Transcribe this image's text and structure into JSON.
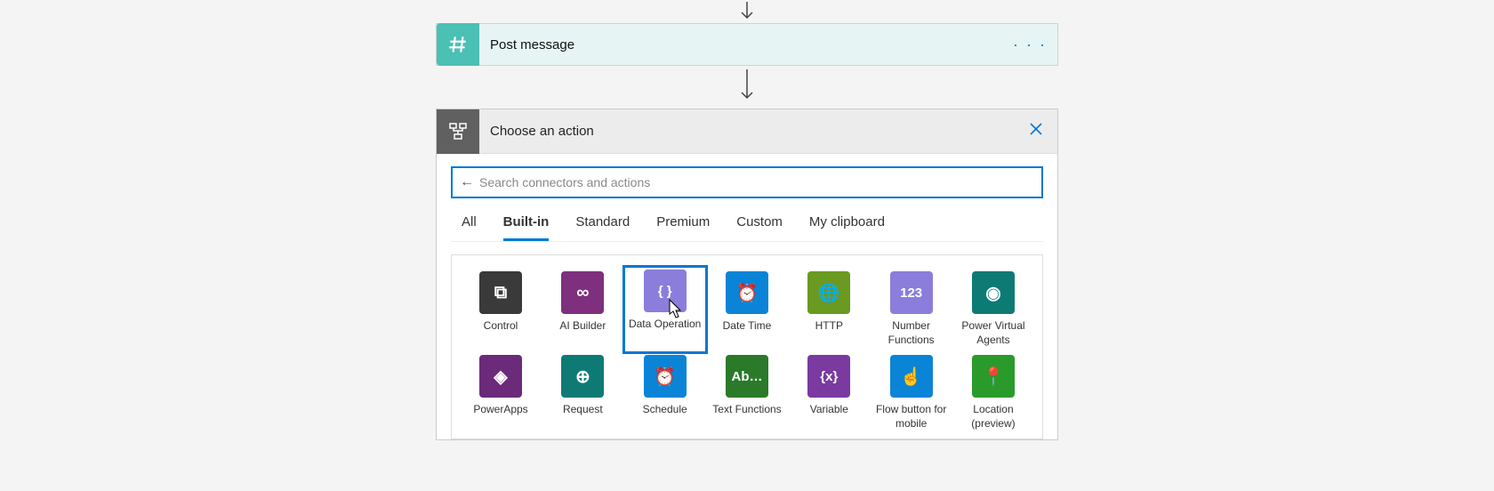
{
  "step": {
    "title": "Post message",
    "icon_name": "hash-icon",
    "icon_bg": "#4bc0b5"
  },
  "panel": {
    "title": "Choose an action",
    "close_label": "×",
    "search_placeholder": "Search connectors and actions"
  },
  "tabs": [
    {
      "label": "All",
      "active": false
    },
    {
      "label": "Built-in",
      "active": true
    },
    {
      "label": "Standard",
      "active": false
    },
    {
      "label": "Premium",
      "active": false
    },
    {
      "label": "Custom",
      "active": false
    },
    {
      "label": "My clipboard",
      "active": false
    }
  ],
  "connectors": {
    "row1": [
      {
        "label": "Control",
        "bg": "#3a3a3a",
        "glyph": "⧉",
        "selected": false
      },
      {
        "label": "AI Builder",
        "bg": "#7e2f7e",
        "glyph": "∞",
        "selected": false
      },
      {
        "label": "Data Operation",
        "bg": "#8b7ddb",
        "glyph": "{ }",
        "selected": true
      },
      {
        "label": "Date Time",
        "bg": "#0a84d6",
        "glyph": "⏰",
        "selected": false
      },
      {
        "label": "HTTP",
        "bg": "#6a9a1f",
        "glyph": "🌐",
        "selected": false
      },
      {
        "label": "Number Functions",
        "bg": "#8b7ddb",
        "glyph": "123",
        "selected": false
      },
      {
        "label": "Power Virtual Agents",
        "bg": "#0e7a74",
        "glyph": "◉",
        "selected": false
      }
    ],
    "row2": [
      {
        "label": "PowerApps",
        "bg": "#6b2a7a",
        "glyph": "◈",
        "selected": false
      },
      {
        "label": "Request",
        "bg": "#0e7a74",
        "glyph": "⊕",
        "selected": false
      },
      {
        "label": "Schedule",
        "bg": "#0a84d6",
        "glyph": "⏰",
        "selected": false
      },
      {
        "label": "Text Functions",
        "bg": "#2a7a2a",
        "glyph": "Ab…",
        "selected": false
      },
      {
        "label": "Variable",
        "bg": "#7a3aa0",
        "glyph": "{x}",
        "selected": false
      },
      {
        "label": "Flow button for mobile",
        "bg": "#0a84d6",
        "glyph": "☝",
        "selected": false
      },
      {
        "label": "Location (preview)",
        "bg": "#2a9a2a",
        "glyph": "📍",
        "selected": false
      }
    ]
  }
}
